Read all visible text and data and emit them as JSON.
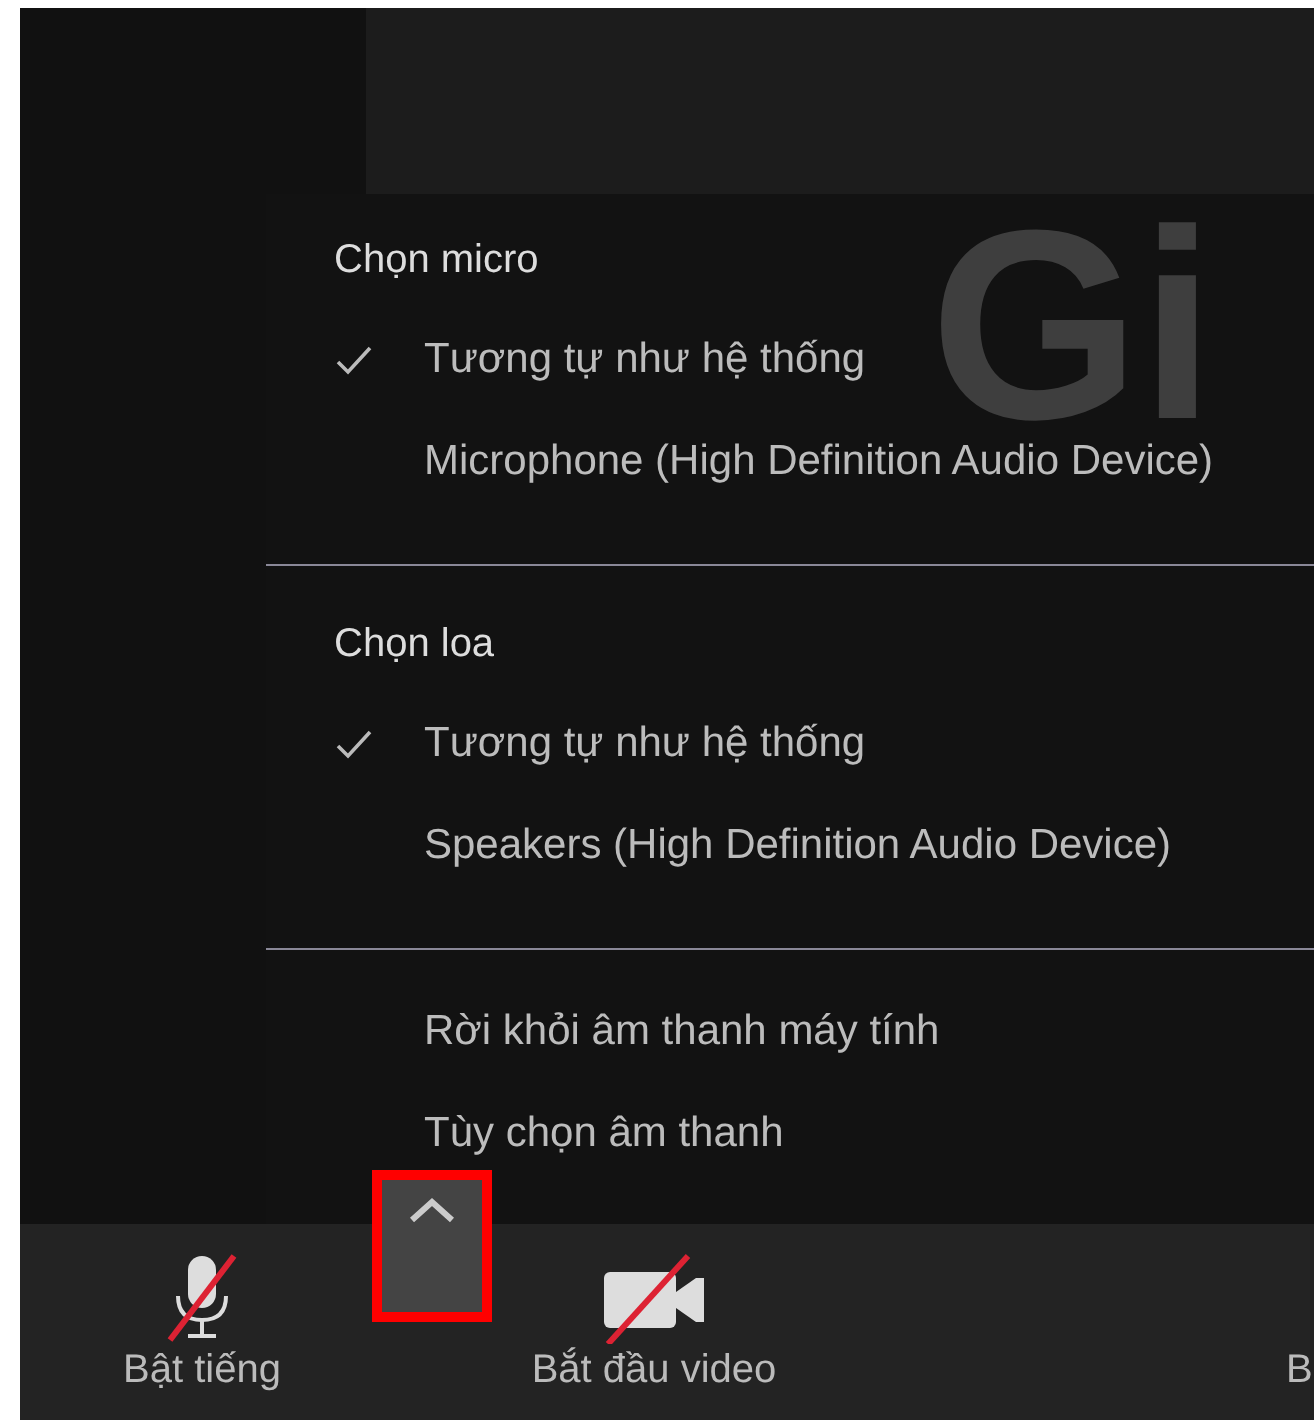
{
  "background_text": "Gi",
  "audio_menu": {
    "sections": [
      {
        "heading": "Chọn micro",
        "items": [
          {
            "label": "Tương tự như hệ thống",
            "checked": true
          },
          {
            "label": "Microphone (High Definition Audio Device)",
            "checked": false
          }
        ]
      },
      {
        "heading": "Chọn loa",
        "items": [
          {
            "label": "Tương tự như hệ thống",
            "checked": true
          },
          {
            "label": "Speakers (High Definition Audio Device)",
            "checked": false
          }
        ]
      },
      {
        "items": [
          {
            "label": "Rời khỏi âm thanh máy tính",
            "checked": false
          },
          {
            "label": "Tùy chọn âm thanh",
            "checked": false
          }
        ]
      }
    ]
  },
  "toolbar": {
    "buttons": [
      {
        "kind": "mic",
        "label": "Bật tiếng",
        "muted": true
      },
      {
        "kind": "caret",
        "highlighted": true
      },
      {
        "kind": "video",
        "label": "Bắt đầu video",
        "muted": true
      },
      {
        "kind": "cut",
        "label": "B"
      }
    ]
  }
}
